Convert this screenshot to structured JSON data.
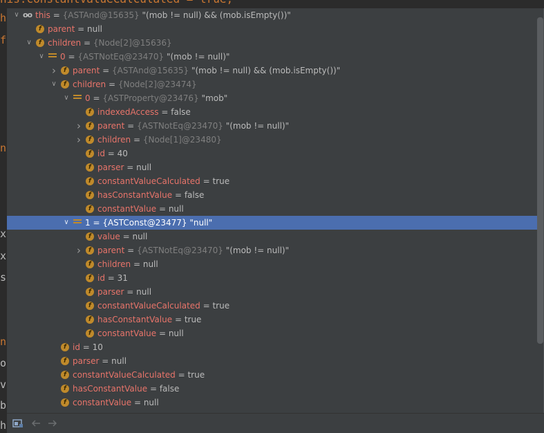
{
  "editor": {
    "code_line": "his.constantValueCalculated = true;",
    "gutter": [
      "h",
      "f",
      "n",
      "x",
      "x",
      "s",
      "n",
      "o",
      "v",
      "b",
      "h"
    ]
  },
  "tree": [
    {
      "depth": 0,
      "arrow": "down",
      "icon": "oo",
      "name": "this",
      "type": "{ASTAnd@15635}",
      "value": "\"(mob != null) && (mob.isEmpty())\""
    },
    {
      "depth": 1,
      "arrow": "none",
      "icon": "f",
      "name": "parent",
      "type": "",
      "value": "null"
    },
    {
      "depth": 1,
      "arrow": "down",
      "icon": "f",
      "name": "children",
      "type": "{Node[2]@15636}",
      "value": ""
    },
    {
      "depth": 2,
      "arrow": "down",
      "icon": "arr",
      "name": "0",
      "type": "{ASTNotEq@23470}",
      "value": "\"(mob != null)\""
    },
    {
      "depth": 3,
      "arrow": "right",
      "icon": "f",
      "name": "parent",
      "type": "{ASTAnd@15635}",
      "value": "\"(mob != null) && (mob.isEmpty())\""
    },
    {
      "depth": 3,
      "arrow": "down",
      "icon": "f",
      "name": "children",
      "type": "{Node[2]@23474}",
      "value": ""
    },
    {
      "depth": 4,
      "arrow": "down",
      "icon": "arr",
      "name": "0",
      "type": "{ASTProperty@23476}",
      "value": "\"mob\""
    },
    {
      "depth": 5,
      "arrow": "none",
      "icon": "f",
      "name": "indexedAccess",
      "type": "",
      "value": "false"
    },
    {
      "depth": 5,
      "arrow": "right",
      "icon": "f",
      "name": "parent",
      "type": "{ASTNotEq@23470}",
      "value": "\"(mob != null)\""
    },
    {
      "depth": 5,
      "arrow": "right",
      "icon": "f",
      "name": "children",
      "type": "{Node[1]@23480}",
      "value": ""
    },
    {
      "depth": 5,
      "arrow": "none",
      "icon": "f",
      "name": "id",
      "type": "",
      "value": "40"
    },
    {
      "depth": 5,
      "arrow": "none",
      "icon": "f",
      "name": "parser",
      "type": "",
      "value": "null"
    },
    {
      "depth": 5,
      "arrow": "none",
      "icon": "f",
      "name": "constantValueCalculated",
      "type": "",
      "value": "true"
    },
    {
      "depth": 5,
      "arrow": "none",
      "icon": "f",
      "name": "hasConstantValue",
      "type": "",
      "value": "false"
    },
    {
      "depth": 5,
      "arrow": "none",
      "icon": "f",
      "name": "constantValue",
      "type": "",
      "value": "null"
    },
    {
      "depth": 4,
      "arrow": "down",
      "icon": "arr",
      "name": "1",
      "type": "{ASTConst@23477}",
      "value": "\"null\"",
      "selected": true
    },
    {
      "depth": 5,
      "arrow": "none",
      "icon": "f",
      "name": "value",
      "type": "",
      "value": "null"
    },
    {
      "depth": 5,
      "arrow": "right",
      "icon": "f",
      "name": "parent",
      "type": "{ASTNotEq@23470}",
      "value": "\"(mob != null)\""
    },
    {
      "depth": 5,
      "arrow": "none",
      "icon": "f",
      "name": "children",
      "type": "",
      "value": "null"
    },
    {
      "depth": 5,
      "arrow": "none",
      "icon": "f",
      "name": "id",
      "type": "",
      "value": "31"
    },
    {
      "depth": 5,
      "arrow": "none",
      "icon": "f",
      "name": "parser",
      "type": "",
      "value": "null"
    },
    {
      "depth": 5,
      "arrow": "none",
      "icon": "f",
      "name": "constantValueCalculated",
      "type": "",
      "value": "true"
    },
    {
      "depth": 5,
      "arrow": "none",
      "icon": "f",
      "name": "hasConstantValue",
      "type": "",
      "value": "true"
    },
    {
      "depth": 5,
      "arrow": "none",
      "icon": "f",
      "name": "constantValue",
      "type": "",
      "value": "null"
    },
    {
      "depth": 3,
      "arrow": "none",
      "icon": "f",
      "name": "id",
      "type": "",
      "value": "10"
    },
    {
      "depth": 3,
      "arrow": "none",
      "icon": "f",
      "name": "parser",
      "type": "",
      "value": "null"
    },
    {
      "depth": 3,
      "arrow": "none",
      "icon": "f",
      "name": "constantValueCalculated",
      "type": "",
      "value": "true"
    },
    {
      "depth": 3,
      "arrow": "none",
      "icon": "f",
      "name": "hasConstantValue",
      "type": "",
      "value": "false"
    },
    {
      "depth": 3,
      "arrow": "none",
      "icon": "f",
      "name": "constantValue",
      "type": "",
      "value": "null"
    }
  ],
  "toolbar": {
    "icons": [
      "layout-icon",
      "back-arrow-icon",
      "forward-arrow-icon"
    ]
  },
  "colors": {
    "field_name": "#e8746a",
    "type_ref": "#7f7f7f",
    "field_icon": "#c08a2b",
    "selection": "#4b6eaf",
    "panel_bg": "#3c3f41"
  }
}
